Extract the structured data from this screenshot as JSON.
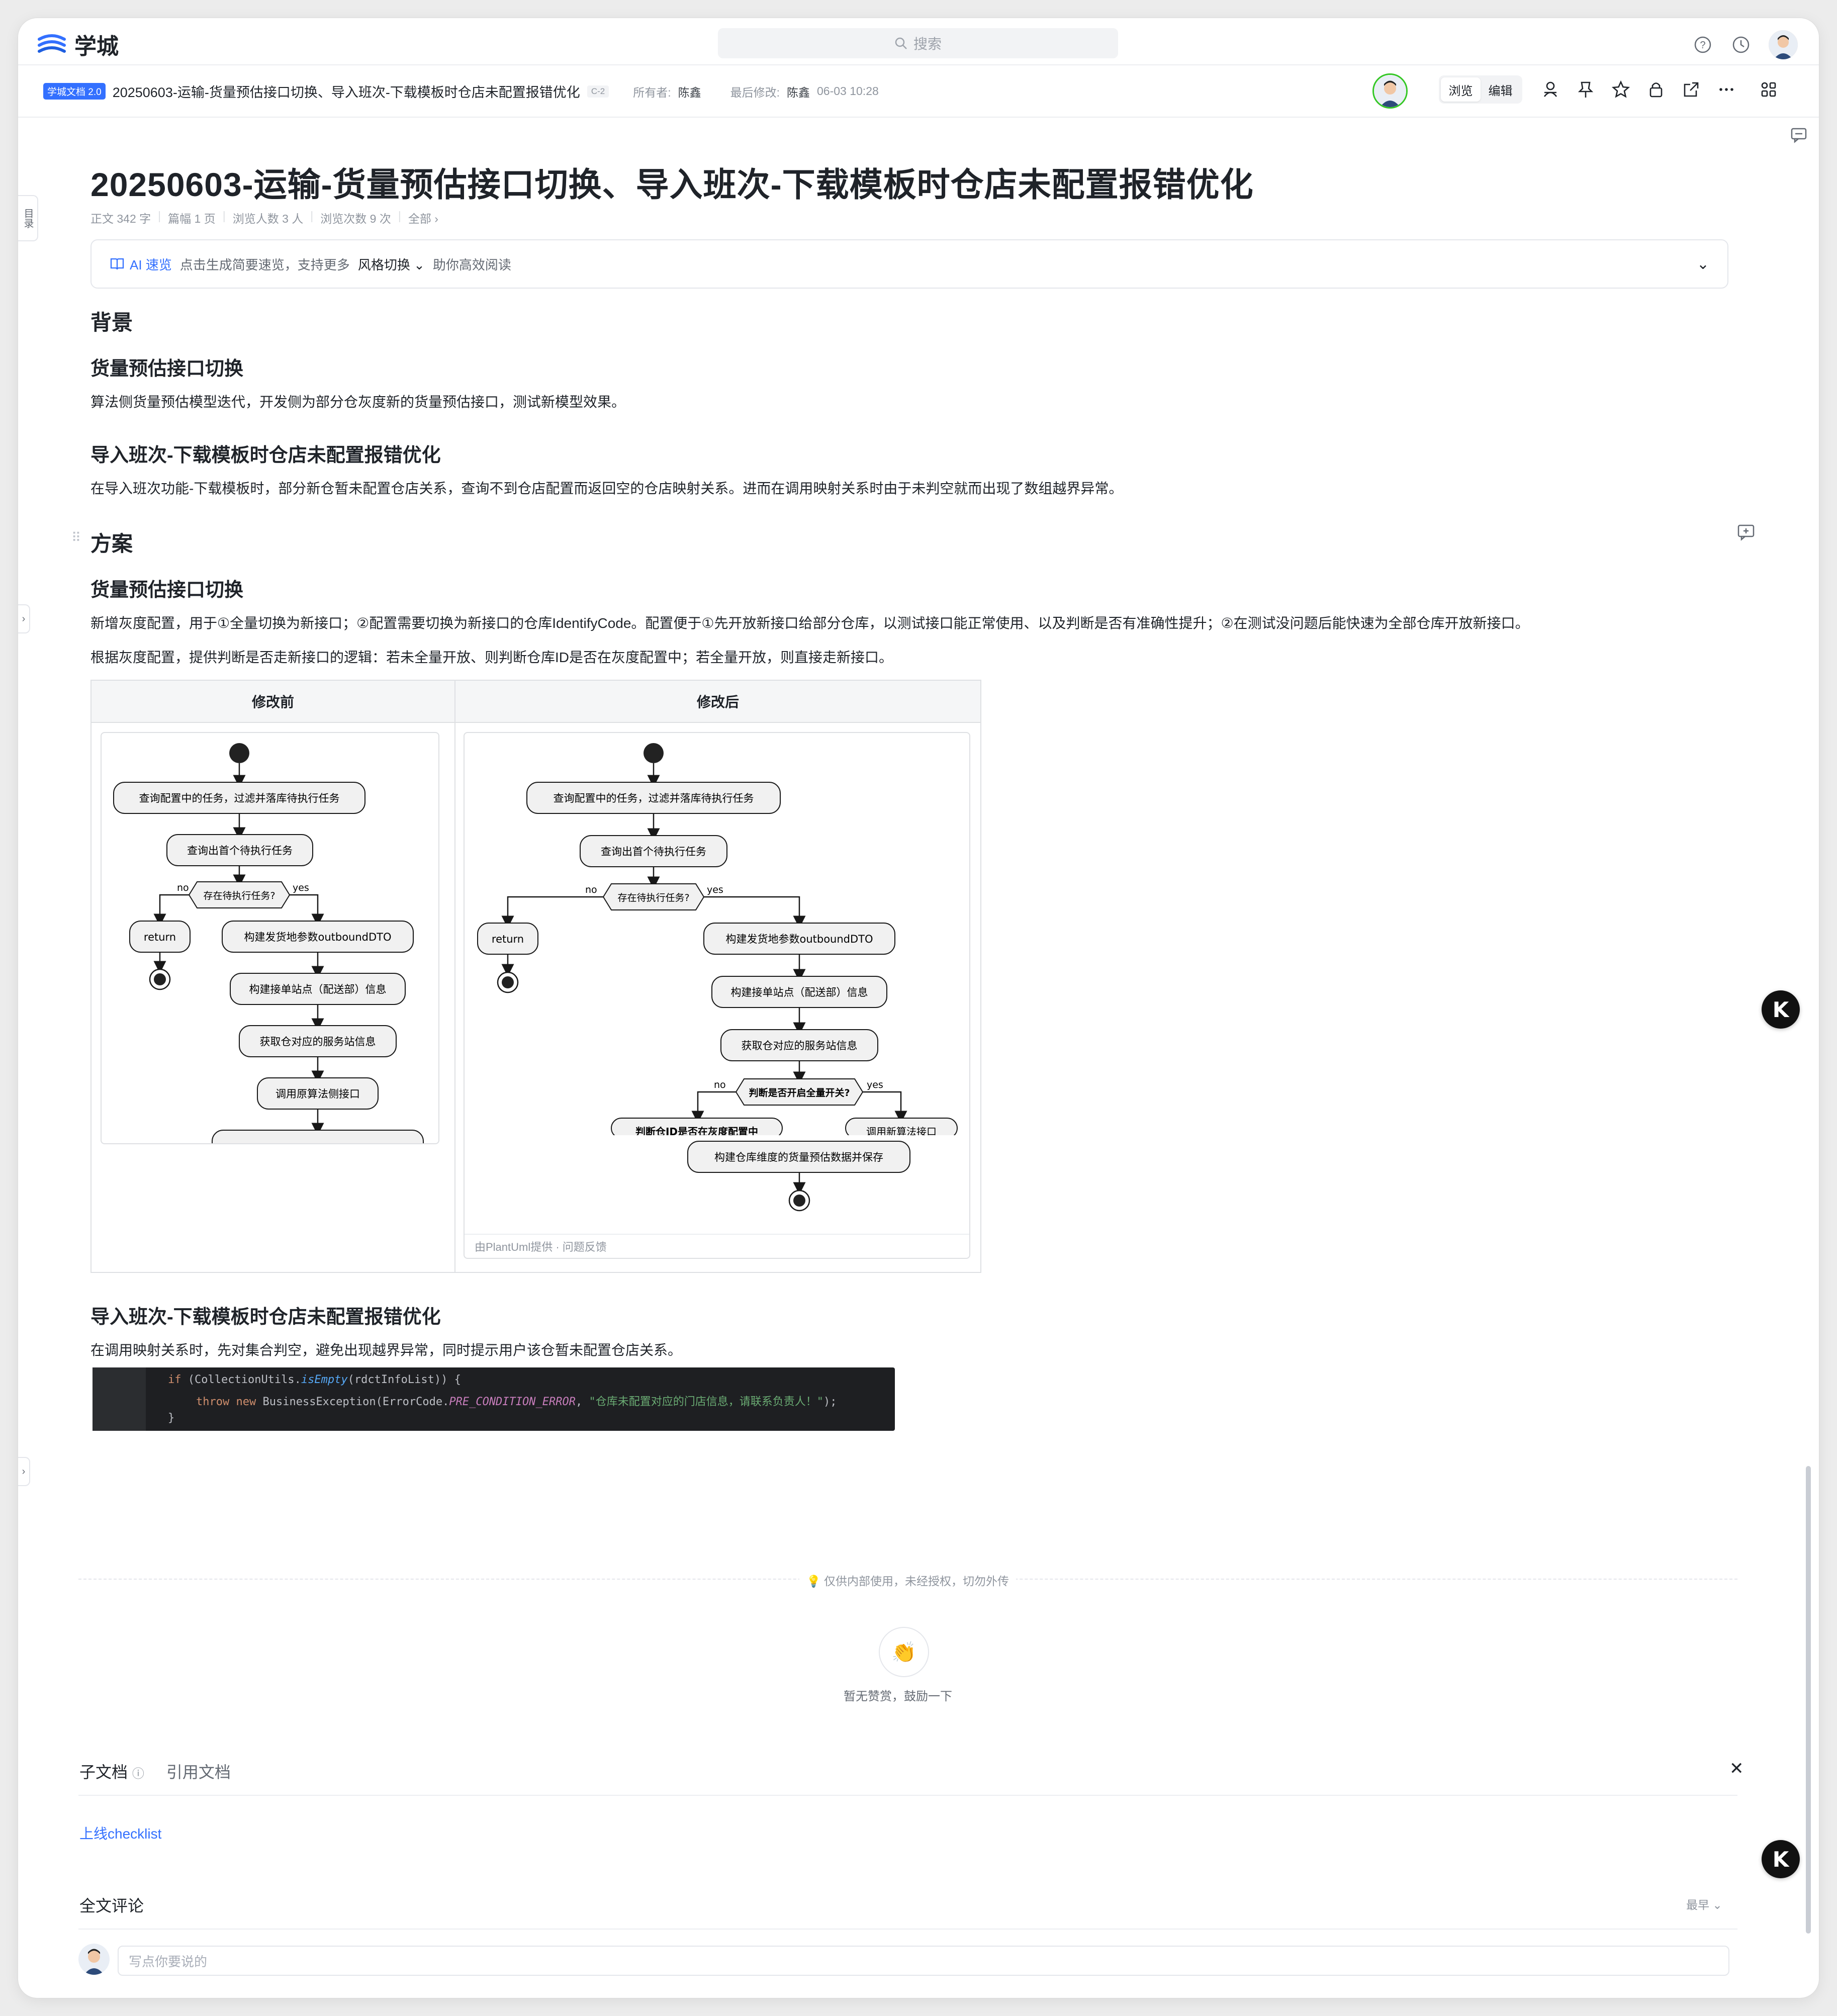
{
  "app": {
    "name": "学城",
    "search_placeholder": "搜索"
  },
  "docbar": {
    "badge": "学城文档 2.0",
    "title": "20250603-运输-货量预估接口切换、导入班次-下载模板时仓店未配置报错优化",
    "tag": "C-2",
    "owner_label": "所有者:",
    "owner": "陈鑫",
    "modified_label": "最后修改:",
    "modified_by": "陈鑫",
    "modified_time": "06-03 10:28",
    "mode_view": "浏览",
    "mode_edit": "编辑"
  },
  "sidebar": {
    "toc_label": "目录"
  },
  "doc": {
    "title": "20250603-运输-货量预估接口切换、导入班次-下载模板时仓店未配置报错优化",
    "stats": [
      "正文 342 字",
      "篇幅 1 页",
      "浏览人数 3 人",
      "浏览次数 9 次",
      "全部 ›"
    ],
    "ai": {
      "label": "AI 速览",
      "desc": "点击生成简要速览，支持更多",
      "style": "风格切换",
      "help": "助你高效阅读"
    },
    "background_heading": "背景",
    "bg_sub1": "货量预估接口切换",
    "bg_p1": "算法侧货量预估模型迭代，开发侧为部分仓灰度新的货量预估接口，测试新模型效果。",
    "bg_sub2": "导入班次-下载模板时仓店未配置报错优化",
    "bg_p2": "在导入班次功能-下载模板时，部分新仓暂未配置仓店关系，查询不到仓店配置而返回空的仓店映射关系。进而在调用映射关系时由于未判空就而出现了数组越界异常。",
    "plan_heading": "方案",
    "plan_sub1": "货量预估接口切换",
    "plan_p1": "新增灰度配置，用于①全量切换为新接口；②配置需要切换为新接口的仓库IdentifyCode。配置便于①先开放新接口给部分仓库，以测试接口能正常使用、以及判断是否有准确性提升；②在测试没问题后能快速为全部仓库开放新接口。",
    "plan_p2": "根据灰度配置，提供判断是否走新接口的逻辑：若未全量开放、则判断仓库ID是否在灰度配置中；若全量开放，则直接走新接口。",
    "table": {
      "col_before": "修改前",
      "col_after": "修改后"
    },
    "plan_sub2": "导入班次-下载模板时仓店未配置报错优化",
    "plan_p3": "在调用映射关系时，先对集合判空，避免出现越界异常，同时提示用户该仓暂未配置仓店关系。",
    "code": {
      "line1_kw": "if",
      "line1_a": " (CollectionUtils.",
      "line1_fn": "isEmpty",
      "line1_b": "(rdctInfoList)) {",
      "line2_kw1": "throw",
      "line2_kw2": "new",
      "line2_a": " BusinessException(ErrorCode.",
      "line2_const": "PRE_CONDITION_ERROR",
      "line2_b": ", ",
      "line2_str": "\"仓库未配置对应的门店信息，请联系负责人！\"",
      "line2_c": ");",
      "line3": "}"
    }
  },
  "diagram_before": {
    "n1": "查询配置中的任务，过滤并落库待执行任务",
    "n2": "查询出首个待执行任务",
    "decision": "存在待执行任务?",
    "no": "no",
    "yes": "yes",
    "ret": "return",
    "n3": "构建发货地参数outboundDTO",
    "n4": "构建接单站点（配送部）信息",
    "n5": "获取仓对应的服务站信息",
    "n6": "调用原算法侧接口"
  },
  "diagram_after": {
    "n1": "查询配置中的任务，过滤并落库待执行任务",
    "n2": "查询出首个待执行任务",
    "decision": "存在待执行任务?",
    "no": "no",
    "yes": "yes",
    "ret": "return",
    "n3": "构建发货地参数outboundDTO",
    "n4": "构建接单站点（配送部）信息",
    "n5": "获取仓对应的服务站信息",
    "decision2": "判断是否开启全量开关?",
    "n6a": "判断仓ID是否在灰度配置中",
    "n6b": "调用新算法接口",
    "n7": "构建仓库维度的货量预估数据并保存",
    "footer": "由PlantUml提供 · 问题反馈"
  },
  "footer": {
    "notice": "仅供内部使用，未经授权，切勿外传",
    "like_text": "暂无赞赏，鼓励一下",
    "tab_children": "子文档",
    "tab_refs": "引用文档",
    "child_link": "上线checklist",
    "comments_title": "全文评论",
    "sort": "最早 ⌄",
    "comment_placeholder": "写点你要说的"
  },
  "float": {
    "k": "K"
  },
  "colors": {
    "accent": "#3370ff",
    "text": "#1f2329",
    "muted": "#8f959e"
  }
}
